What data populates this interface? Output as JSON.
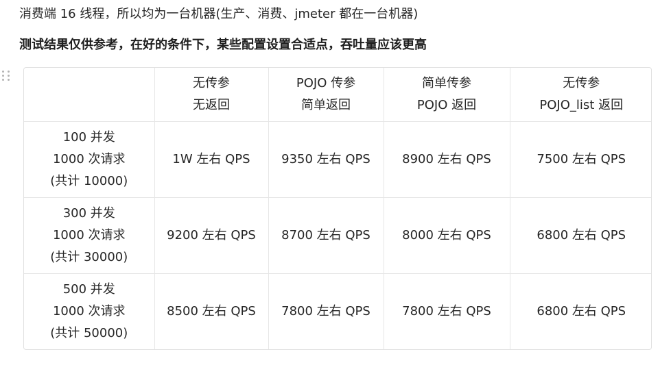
{
  "intro": "消费端 16 线程，所以均为一台机器(生产、消费、jmeter 都在一台机器)",
  "note": "测试结果仅供参考，在好的条件下，某些配置设置合适点，吞吐量应该更高",
  "table": {
    "headers": [
      [],
      [
        "无传参",
        "无返回"
      ],
      [
        "POJO 传参",
        "简单返回"
      ],
      [
        "简单传参",
        "POJO 返回"
      ],
      [
        "无传参",
        "POJO_list 返回"
      ]
    ],
    "rows": [
      {
        "label": [
          "100 并发",
          "1000 次请求",
          "(共计 10000)"
        ],
        "values": [
          "1W 左右 QPS",
          "9350 左右 QPS",
          "8900 左右 QPS",
          "7500 左右 QPS"
        ]
      },
      {
        "label": [
          "300 并发",
          "1000 次请求",
          "(共计 30000)"
        ],
        "values": [
          "9200 左右 QPS",
          "8700 左右 QPS",
          "8000 左右 QPS",
          "6800 左右 QPS"
        ]
      },
      {
        "label": [
          "500 并发",
          "1000 次请求",
          "(共计 50000)"
        ],
        "values": [
          "8500 左右 QPS",
          "7800 左右 QPS",
          "7800 左右 QPS",
          "6800 左右 QPS"
        ]
      }
    ]
  }
}
